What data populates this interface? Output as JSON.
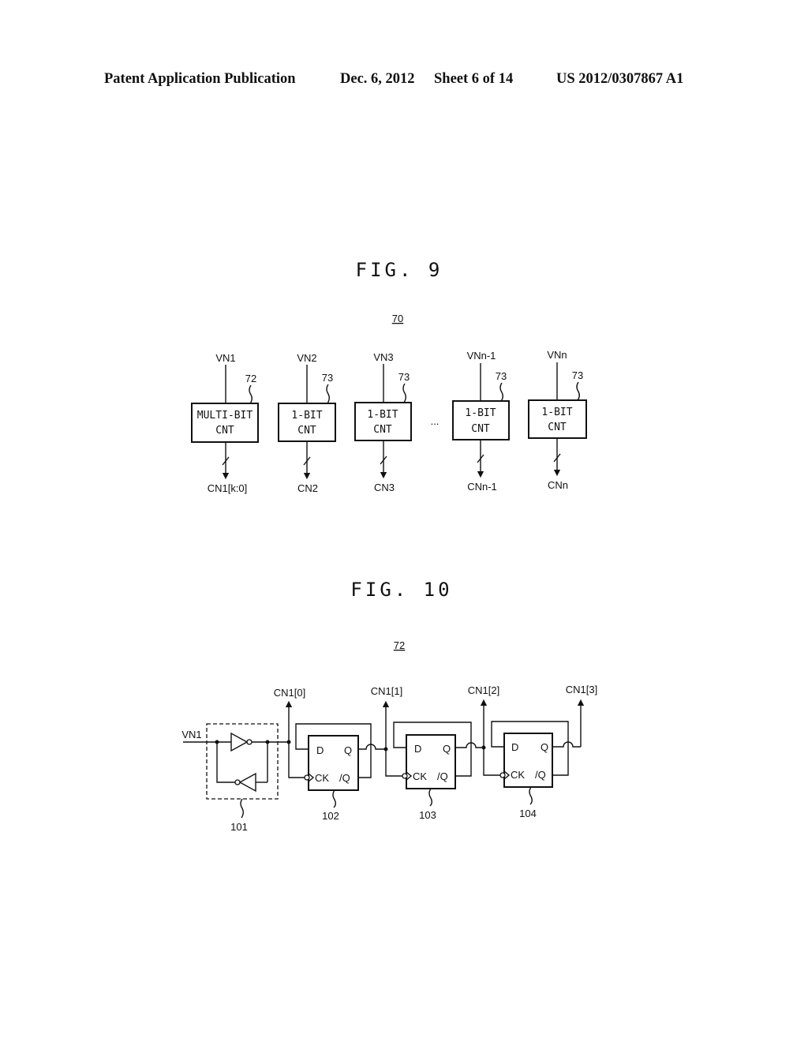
{
  "header": {
    "publication": "Patent Application Publication",
    "date": "Dec. 6, 2012",
    "sheet": "Sheet 6 of 14",
    "number": "US 2012/0307867 A1"
  },
  "fig9": {
    "title": "FIG. 9",
    "ref": "70",
    "ellipsis": "...",
    "blocks": [
      {
        "input": "VN1",
        "ref": "72",
        "line1": "MULTI-BIT",
        "line2": "CNT",
        "output": "CN1[k:0]"
      },
      {
        "input": "VN2",
        "ref": "73",
        "line1": "1-BIT",
        "line2": "CNT",
        "output": "CN2"
      },
      {
        "input": "VN3",
        "ref": "73",
        "line1": "1-BIT",
        "line2": "CNT",
        "output": "CN3"
      },
      {
        "input": "VNn-1",
        "ref": "73",
        "line1": "1-BIT",
        "line2": "CNT",
        "output": "CNn-1"
      },
      {
        "input": "VNn",
        "ref": "73",
        "line1": "1-BIT",
        "line2": "CNT",
        "output": "CNn"
      }
    ]
  },
  "fig10": {
    "title": "FIG. 10",
    "ref": "72",
    "input": "VN1",
    "buffer_ref": "101",
    "outputs": [
      "CN1[0]",
      "CN1[1]",
      "CN1[2]",
      "CN1[3]"
    ],
    "flipflops": [
      {
        "ref": "102",
        "d": "D",
        "q": "Q",
        "ck": "CK",
        "qb": "/Q"
      },
      {
        "ref": "103",
        "d": "D",
        "q": "Q",
        "ck": "CK",
        "qb": "/Q"
      },
      {
        "ref": "104",
        "d": "D",
        "q": "Q",
        "ck": "CK",
        "qb": "/Q"
      }
    ]
  }
}
